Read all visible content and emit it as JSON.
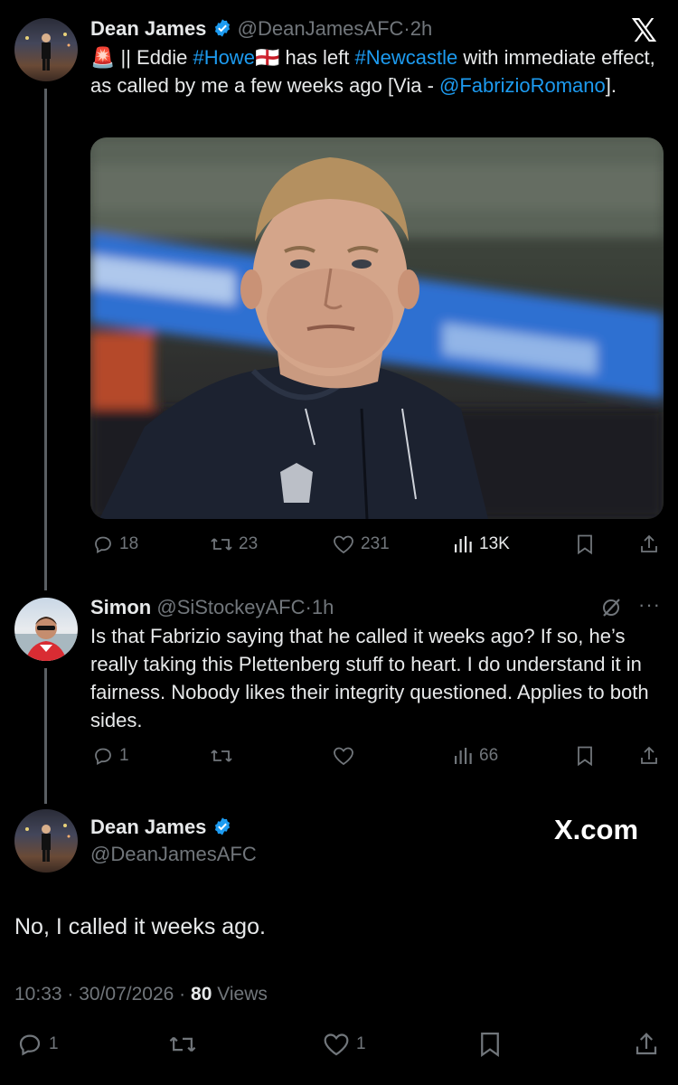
{
  "tweet1": {
    "name": "Dean James",
    "handle": "@DeanJamesAFC",
    "time": "2h",
    "siren": "🚨",
    "text_part1": " || Eddie ",
    "hashtag1": "#Howe",
    "flag": "🏴󠁧󠁢󠁥󠁮󠁧󠁿",
    "text_part2": " has left ",
    "hashtag2": "#Newcastle",
    "text_part3": " with immediate effect, as called by me a few weeks ago [Via - ",
    "mention": "@FabrizioRomano",
    "text_part4": "].",
    "replies": "18",
    "reposts": "23",
    "likes": "231",
    "views": "13K"
  },
  "tweet2": {
    "name": "Simon",
    "handle": "@SiStockeyAFC",
    "time": "1h",
    "text": "Is that Fabrizio saying that he called it weeks ago? If so, he’s really taking this Plettenberg stuff to heart. I do understand it in fairness. Nobody likes their integrity questioned. Applies to both sides.",
    "replies": "1",
    "views": "66",
    "more": "···"
  },
  "tweet3": {
    "name": "Dean James",
    "handle": "@DeanJamesAFC",
    "text": "No, I called it weeks ago.",
    "time": "10:33",
    "date": "30/07/2026",
    "views_count": "80",
    "views_label": "Views",
    "replies": "1",
    "likes": "1"
  },
  "brand": {
    "x_logo": "𝕏",
    "watermark": "X.com"
  },
  "colors": {
    "accent": "#1d9bf0",
    "muted": "#71767b",
    "background": "#000000"
  }
}
